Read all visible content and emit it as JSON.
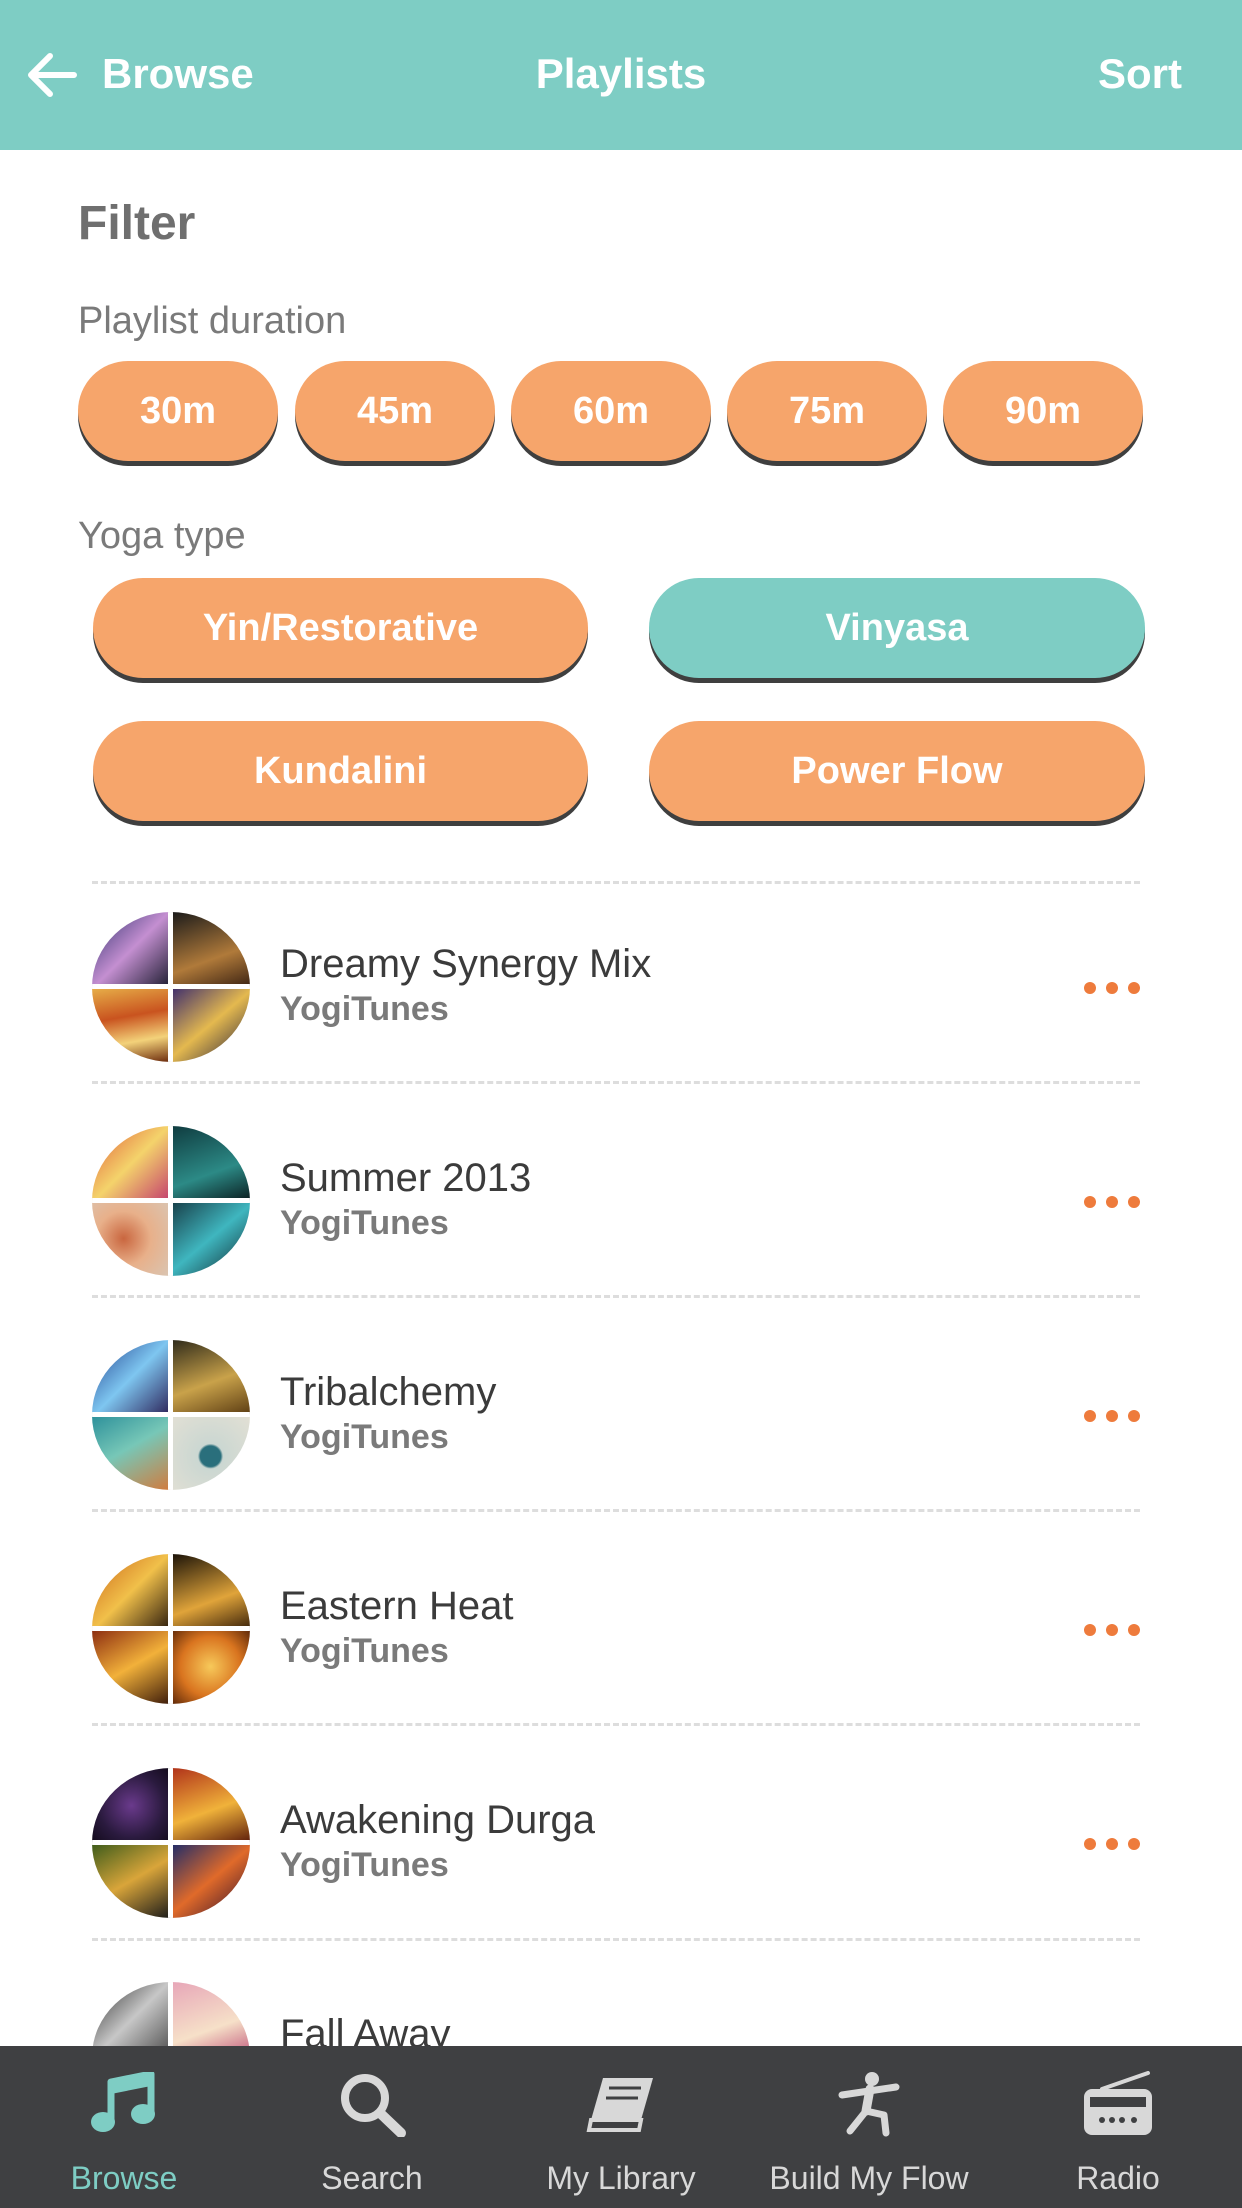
{
  "header": {
    "back_label": "Browse",
    "title": "Playlists",
    "sort_label": "Sort",
    "back_icon": "arrow-left-icon"
  },
  "filter": {
    "title": "Filter",
    "duration_label": "Playlist duration",
    "durations": [
      "30m",
      "45m",
      "60m",
      "75m",
      "90m"
    ],
    "yoga_label": "Yoga type",
    "yoga_types": [
      "Yin/Restorative",
      "Vinyasa",
      "Kundalini",
      "Power Flow"
    ],
    "selected_yoga_type": "Vinyasa"
  },
  "playlists": [
    {
      "name": "Dreamy Synergy Mix",
      "owner": "YogiTunes"
    },
    {
      "name": "Summer 2013",
      "owner": "YogiTunes"
    },
    {
      "name": "Tribalchemy",
      "owner": "YogiTunes"
    },
    {
      "name": "Eastern Heat",
      "owner": "YogiTunes"
    },
    {
      "name": "Awakening Durga",
      "owner": "YogiTunes"
    },
    {
      "name": "Fall Away",
      "owner": ""
    }
  ],
  "nav": {
    "items": [
      {
        "label": "Browse",
        "icon": "music-note-icon",
        "active": true
      },
      {
        "label": "Search",
        "icon": "search-icon",
        "active": false
      },
      {
        "label": "My Library",
        "icon": "book-icon",
        "active": false
      },
      {
        "label": "Build My Flow",
        "icon": "yoga-pose-icon",
        "active": false
      },
      {
        "label": "Radio",
        "icon": "radio-icon",
        "active": false
      }
    ]
  },
  "colors": {
    "accent": "#7ecdc4",
    "pill": "#f6a56b",
    "more_dots": "#ee7b3c",
    "nav_background": "#3f4042"
  }
}
